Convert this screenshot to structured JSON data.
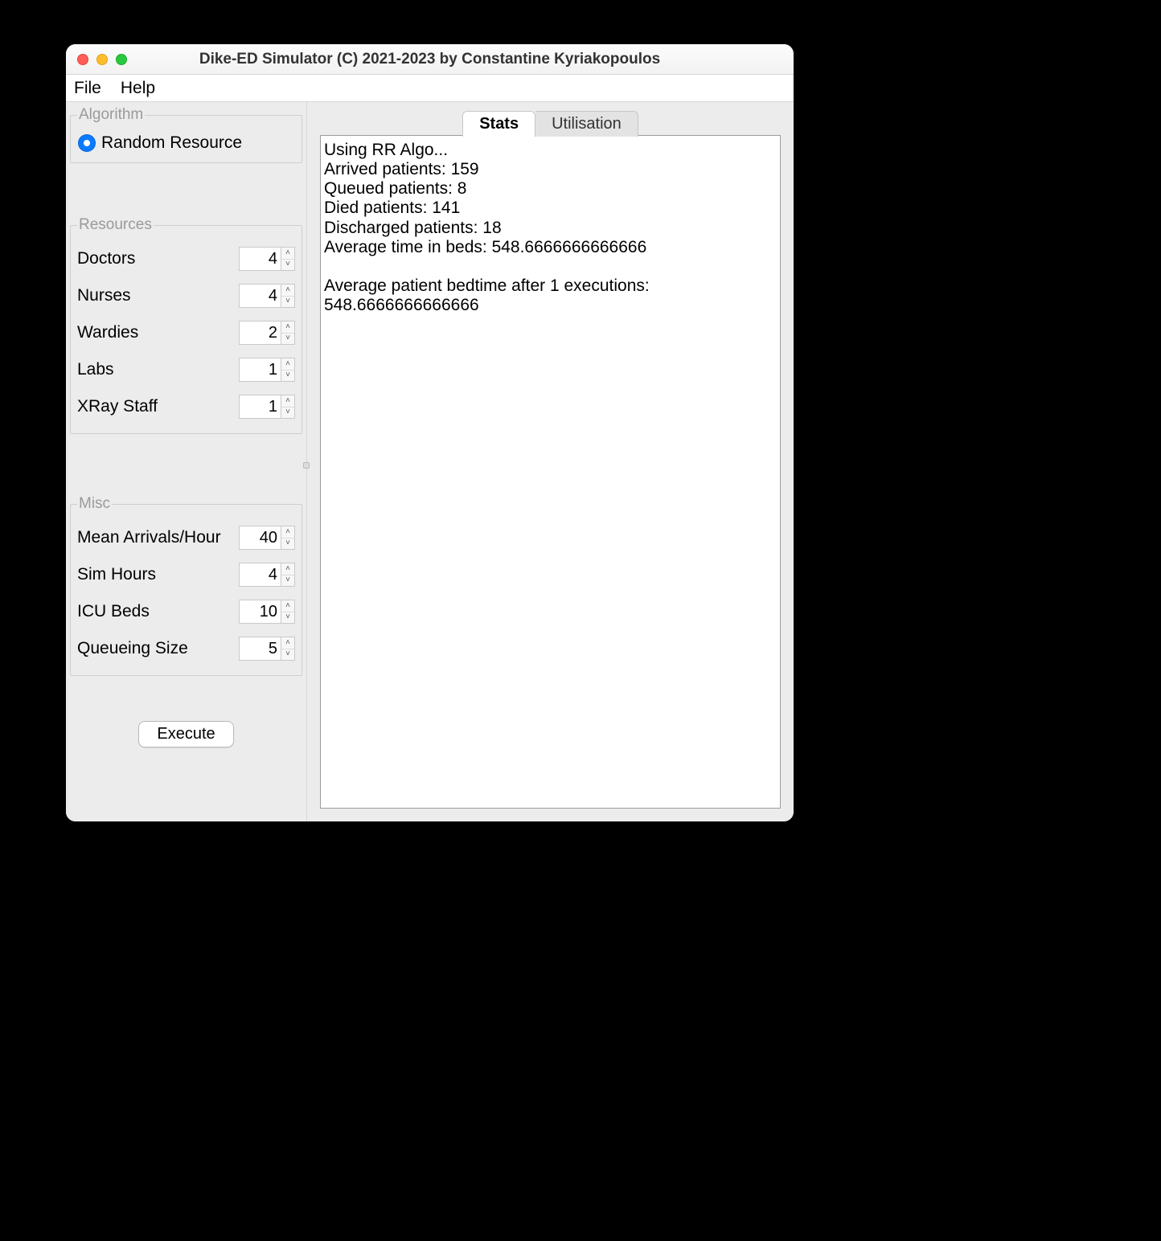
{
  "window": {
    "title": "Dike-ED Simulator (C) 2021-2023 by Constantine Kyriakopoulos"
  },
  "menubar": {
    "file": "File",
    "help": "Help"
  },
  "algorithm": {
    "legend": "Algorithm",
    "option_label": "Random Resource"
  },
  "resources": {
    "legend": "Resources",
    "items": [
      {
        "label": "Doctors",
        "value": "4"
      },
      {
        "label": "Nurses",
        "value": "4"
      },
      {
        "label": "Wardies",
        "value": "2"
      },
      {
        "label": "Labs",
        "value": "1"
      },
      {
        "label": "XRay Staff",
        "value": "1"
      }
    ]
  },
  "misc": {
    "legend": "Misc",
    "items": [
      {
        "label": "Mean Arrivals/Hour",
        "value": "40"
      },
      {
        "label": "Sim Hours",
        "value": "4"
      },
      {
        "label": "ICU Beds",
        "value": "10"
      },
      {
        "label": "Queueing Size",
        "value": "5"
      }
    ]
  },
  "execute_label": "Execute",
  "tabs": {
    "stats": "Stats",
    "utilisation": "Utilisation"
  },
  "output_text": "Using RR Algo...\nArrived patients: 159\nQueued patients: 8\nDied patients: 141\nDischarged patients: 18\nAverage time in beds: 548.6666666666666\n\nAverage patient bedtime after 1 executions: 548.6666666666666"
}
